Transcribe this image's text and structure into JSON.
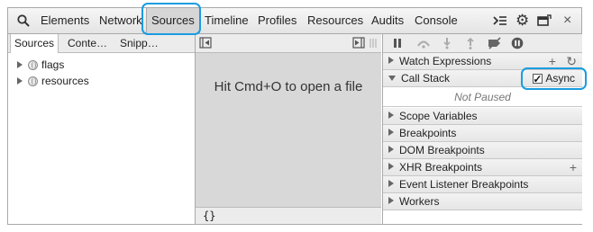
{
  "toolbar": {
    "tabs": [
      "Elements",
      "Network",
      "Sources",
      "Timeline",
      "Profiles",
      "Resources",
      "Audits",
      "Console"
    ],
    "active_tab": "Sources",
    "icons": [
      "search-icon",
      "console-drawer-icon",
      "settings-gear-icon",
      "dock-icon",
      "close-icon"
    ],
    "close_glyph": "×",
    "settings_glyph": "⚙"
  },
  "navigator": {
    "tabs": [
      "Sources",
      "Conte…",
      "Snipp…"
    ],
    "items": [
      {
        "label": "flags"
      },
      {
        "label": "resources"
      }
    ]
  },
  "editor": {
    "message": "Hit Cmd+O to open a file",
    "footer": "{}"
  },
  "debugger": {
    "panes": [
      {
        "title": "Watch Expressions",
        "expanded": false
      },
      {
        "title": "Call Stack",
        "expanded": true
      },
      {
        "title": "Scope Variables",
        "expanded": false
      },
      {
        "title": "Breakpoints",
        "expanded": false
      },
      {
        "title": "DOM Breakpoints",
        "expanded": false
      },
      {
        "title": "XHR Breakpoints",
        "expanded": false
      },
      {
        "title": "Event Listener Breakpoints",
        "expanded": false
      },
      {
        "title": "Workers",
        "expanded": false
      }
    ],
    "call_stack_status": "Not Paused",
    "async_label": "Async",
    "async_checked": true,
    "plus_glyph": "+",
    "refresh_glyph": "↻"
  },
  "colors": {
    "highlight": "#1a9ce0",
    "toolbar_bg": "#e8e8e8",
    "editor_bg": "#d8d8d8"
  }
}
